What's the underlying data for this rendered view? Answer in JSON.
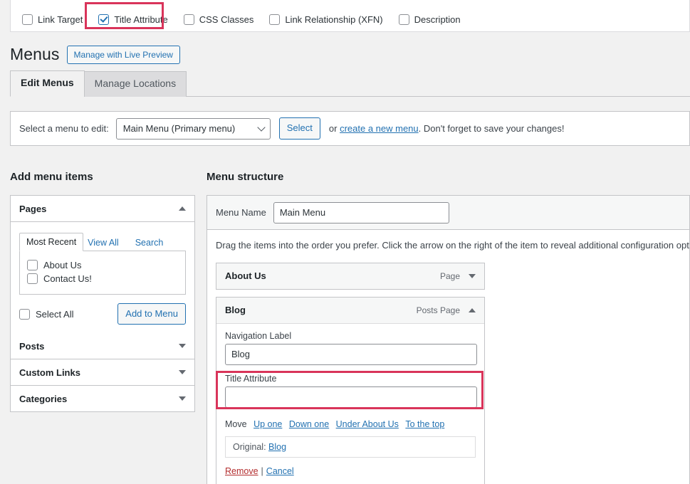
{
  "screen_options": {
    "checkboxes": [
      {
        "label": "Link Target",
        "checked": false
      },
      {
        "label": "Title Attribute",
        "checked": true
      },
      {
        "label": "CSS Classes",
        "checked": false
      },
      {
        "label": "Link Relationship (XFN)",
        "checked": false
      },
      {
        "label": "Description",
        "checked": false
      }
    ]
  },
  "header": {
    "title": "Menus",
    "live_preview_button": "Manage with Live Preview"
  },
  "tabs": [
    {
      "label": "Edit Menus",
      "active": true
    },
    {
      "label": "Manage Locations",
      "active": false
    }
  ],
  "menu_select_bar": {
    "label": "Select a menu to edit:",
    "selected_menu": "Main Menu (Primary menu)",
    "select_button": "Select",
    "or_text": "or",
    "create_link": "create a new menu",
    "tail_text": ". Don't forget to save your changes!"
  },
  "add_menu_items": {
    "heading": "Add menu items",
    "panels": [
      {
        "title": "Pages",
        "expanded": true,
        "tabs": [
          {
            "label": "Most Recent",
            "active": true
          },
          {
            "label": "View All",
            "active": false
          },
          {
            "label": "Search",
            "active": false
          }
        ],
        "items": [
          {
            "label": "About Us",
            "checked": false
          },
          {
            "label": "Contact Us!",
            "checked": false
          }
        ],
        "select_all_label": "Select All",
        "add_button": "Add to Menu"
      },
      {
        "title": "Posts",
        "expanded": false
      },
      {
        "title": "Custom Links",
        "expanded": false
      },
      {
        "title": "Categories",
        "expanded": false
      }
    ]
  },
  "menu_structure": {
    "heading": "Menu structure",
    "menu_name_label": "Menu Name",
    "menu_name_value": "Main Menu",
    "hint": "Drag the items into the order you prefer. Click the arrow on the right of the item to reveal additional configuration options.",
    "items": [
      {
        "title": "About Us",
        "type": "Page",
        "expanded": false
      },
      {
        "title": "Blog",
        "type": "Posts Page",
        "expanded": true,
        "fields": [
          {
            "label": "Navigation Label",
            "value": "Blog",
            "placeholder": "",
            "highlighted": false
          },
          {
            "label": "Title Attribute",
            "value": "",
            "placeholder": "",
            "highlighted": true
          }
        ],
        "move_label": "Move",
        "move_links": [
          "Up one",
          "Down one",
          "Under About Us",
          "To the top"
        ],
        "original_label": "Original:",
        "original_value": "Blog",
        "remove_link": "Remove",
        "separator": "|",
        "cancel_link": "Cancel"
      }
    ]
  },
  "colors": {
    "highlight": "#d9345a",
    "link": "#2271b1",
    "danger": "#b32d2e",
    "page_bg": "#f1f1f1"
  }
}
